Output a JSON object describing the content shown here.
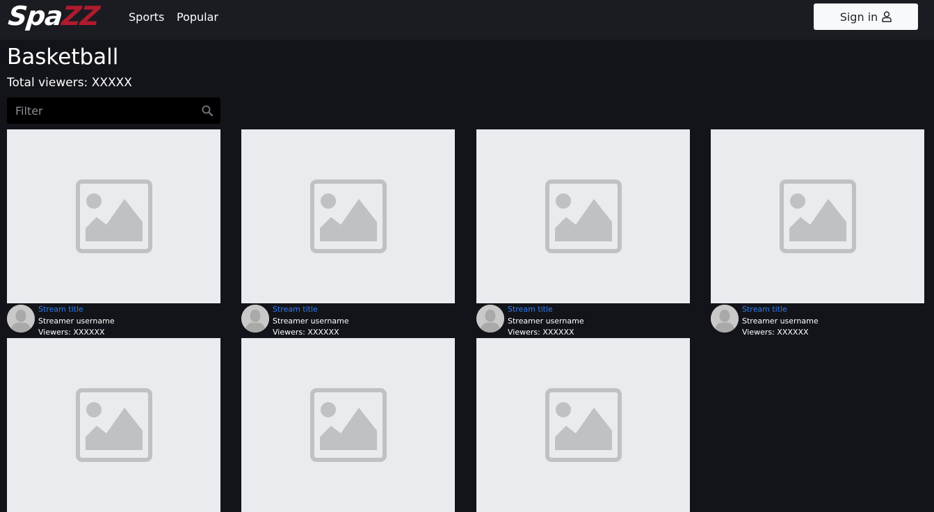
{
  "brand": {
    "logo_part1": "Spa",
    "logo_part2": "ZZ",
    "accent": "#b01a2e"
  },
  "nav": {
    "sports": "Sports",
    "popular": "Popular"
  },
  "signin": {
    "label": "Sign in",
    "icon": "user-icon"
  },
  "page": {
    "title": "Basketball",
    "total_viewers": "Total viewers: XXXXX"
  },
  "filter": {
    "placeholder": "Filter",
    "icon": "search-icon"
  },
  "streams": [
    {
      "title": "Stream title",
      "username": "Streamer username",
      "viewers": "Viewers: XXXXXX"
    },
    {
      "title": "Stream title",
      "username": "Streamer username",
      "viewers": "Viewers: XXXXXX"
    },
    {
      "title": "Stream title",
      "username": "Streamer username",
      "viewers": "Viewers: XXXXXX"
    },
    {
      "title": "Stream title",
      "username": "Streamer username",
      "viewers": "Viewers: XXXXXX"
    }
  ],
  "colors": {
    "background": "#131419",
    "navbar": "#1b1c21",
    "link": "#2d7df6",
    "thumbnail": "#e9ecef"
  }
}
